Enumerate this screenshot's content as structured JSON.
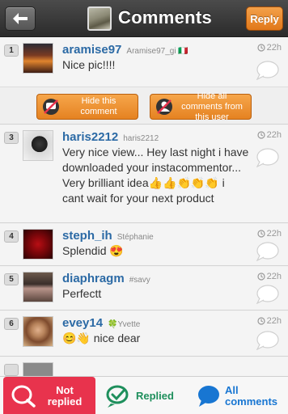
{
  "header": {
    "title": "Comments",
    "reply_label": "Reply"
  },
  "actions": {
    "hide_comment": "Hide this comment",
    "hide_user": "Hide all comments from this user"
  },
  "comments": [
    {
      "number": "1",
      "username": "aramise97",
      "fullname": "Aramise97_gi 🇮🇹",
      "text": "Nice pic!!!!",
      "time": "22h"
    },
    {
      "number": "3",
      "username": "haris2212",
      "fullname": "haris2212",
      "text": "Very nice view... Hey last night i have downloaded your instacommentor... Very brilliant idea👍👍👏👏👏 i cant wait for your next product",
      "time": "22h"
    },
    {
      "number": "4",
      "username": "steph_ih",
      "fullname": "Stéphanie",
      "text": "Splendid 😍",
      "time": "22h"
    },
    {
      "number": "5",
      "username": "diaphragm",
      "fullname": "#savy",
      "text": "Perfectt",
      "time": "22h"
    },
    {
      "number": "6",
      "username": "evey14",
      "fullname": "🍀Yvette",
      "text": "😊👋 nice dear",
      "time": "22h"
    }
  ],
  "tabs": {
    "not_replied": "Not replied",
    "replied": "Replied",
    "all_comments": "All comments"
  },
  "colors": {
    "accent_orange": "#e58221",
    "link_blue": "#2c6aa5",
    "not_replied_red": "#e8334d",
    "replied_green": "#1e8f5c",
    "all_blue": "#1876d2"
  }
}
